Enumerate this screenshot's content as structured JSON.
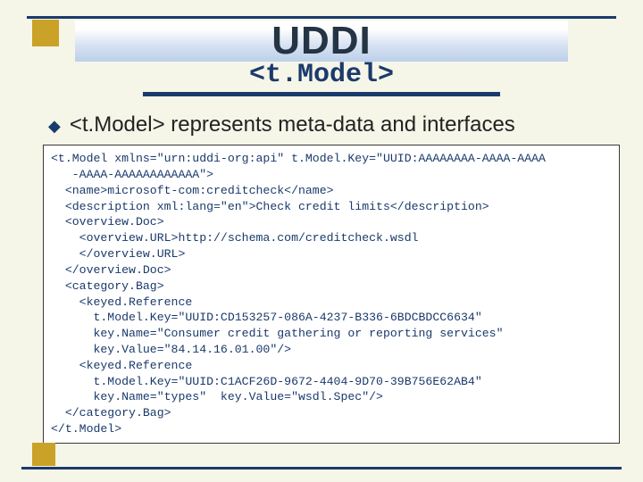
{
  "title": "UDDI",
  "subtitle": "<t.Model>",
  "bullet_text": "<t.Model> represents meta-data and interfaces",
  "code": "<t.Model xmlns=\"urn:uddi-org:api\" t.Model.Key=\"UUID:AAAAAAAA-AAAA-AAAA\n   -AAAA-AAAAAAAAAAAA\">\n  <name>microsoft-com:creditcheck</name>\n  <description xml:lang=\"en\">Check credit limits</description>\n  <overview.Doc>\n    <overview.URL>http://schema.com/creditcheck.wsdl\n    </overview.URL>\n  </overview.Doc>\n  <category.Bag>\n    <keyed.Reference\n      t.Model.Key=\"UUID:CD153257-086A-4237-B336-6BDCBDCC6634\"\n      key.Name=\"Consumer credit gathering or reporting services\"\n      key.Value=\"84.14.16.01.00\"/>\n    <keyed.Reference\n      t.Model.Key=\"UUID:C1ACF26D-9672-4404-9D70-39B756E62AB4\"\n      key.Name=\"types\"  key.Value=\"wsdl.Spec\"/>\n  </category.Bag>\n</t.Model>"
}
